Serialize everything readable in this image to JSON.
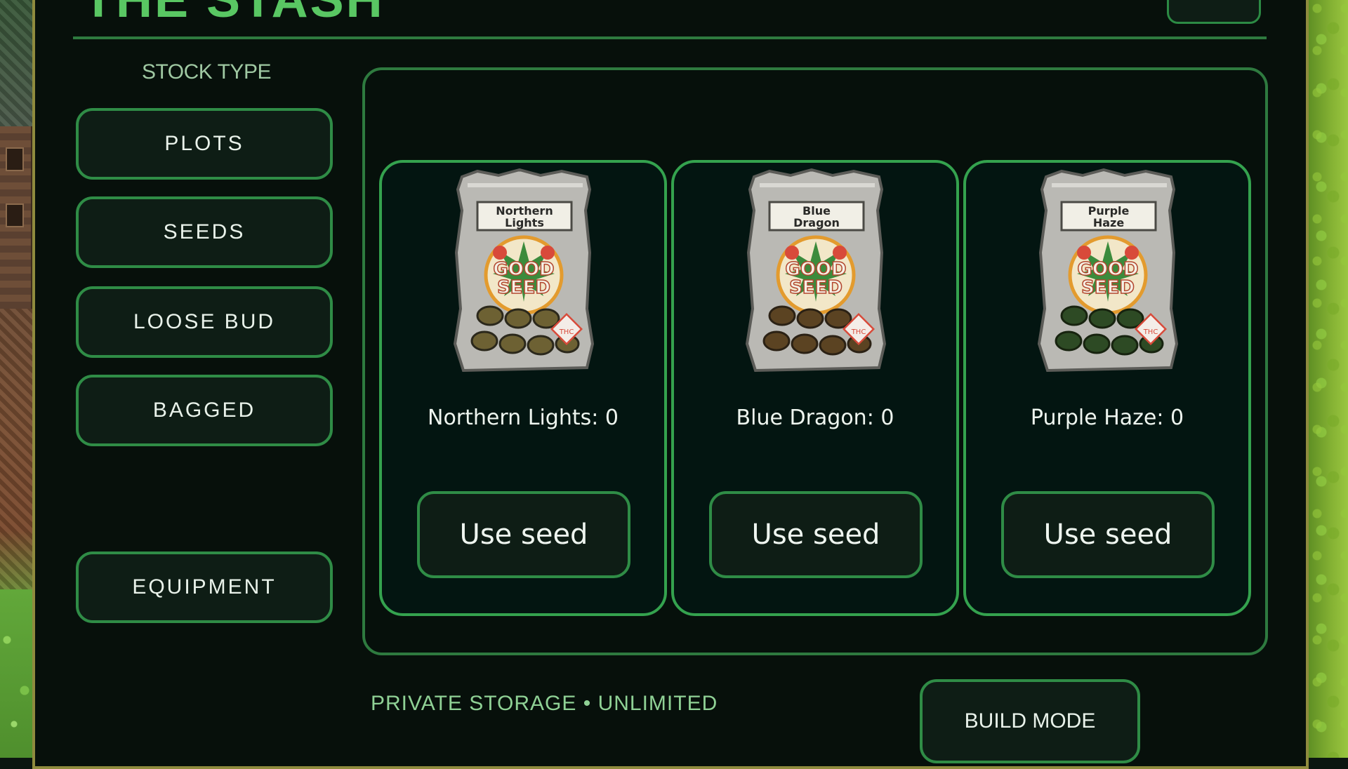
{
  "header": {
    "title": "THE STASH"
  },
  "sidebar": {
    "label": "STOCK TYPE",
    "items": [
      {
        "label": "PLOTS"
      },
      {
        "label": "SEEDS"
      },
      {
        "label": "LOOSE BUD"
      },
      {
        "label": "BAGGED"
      },
      {
        "label": "EQUIPMENT"
      }
    ]
  },
  "cards": [
    {
      "bag_label_line1": "Northern",
      "bag_label_line2": "Lights",
      "count_text": "Northern Lights: 0",
      "button": "Use seed",
      "seed_color": "#6d6133"
    },
    {
      "bag_label_line1": "Blue",
      "bag_label_line2": "Dragon",
      "count_text": "Blue Dragon: 0",
      "button": "Use seed",
      "seed_color": "#5b4322"
    },
    {
      "bag_label_line1": "Purple",
      "bag_label_line2": "Haze",
      "count_text": "Purple Haze: 0",
      "button": "Use seed",
      "seed_color": "#2d4a24"
    }
  ],
  "bag_logo": {
    "line1": "GOOD",
    "line2": "SEED",
    "badge": "THC"
  },
  "footer": {
    "storage_text": "PRIVATE STORAGE  •  UNLIMITED",
    "build_mode": "BUILD MODE"
  },
  "colors": {
    "accent": "#2f8c46",
    "title": "#59c763",
    "panel": "#07100b"
  }
}
